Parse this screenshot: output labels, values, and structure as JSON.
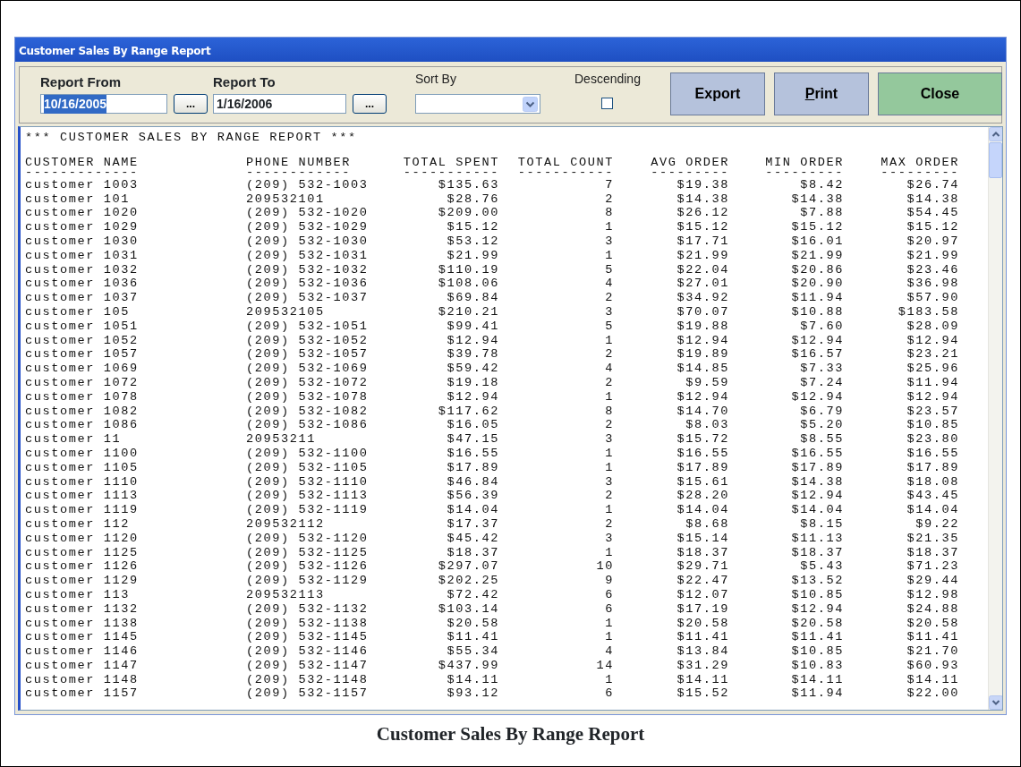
{
  "window": {
    "title": "Customer Sales By Range Report"
  },
  "toolbar": {
    "report_from": {
      "label": "Report From",
      "value": "10/16/2005",
      "text_selected": true,
      "picker": "..."
    },
    "report_to": {
      "label": "Report To",
      "value": "1/16/2006",
      "text_selected": false,
      "picker": "..."
    },
    "sort_by": {
      "label": "Sort By"
    },
    "descending": {
      "label": "Descending",
      "checked": false
    },
    "buttons": [
      {
        "label": "Export",
        "kind": "blue",
        "mnemonic_underlined": false
      },
      {
        "label": "Print",
        "kind": "blue",
        "mnemonic_underlined": true
      },
      {
        "label": "Close",
        "kind": "green",
        "mnemonic_underlined": false
      }
    ]
  },
  "report": {
    "title": "*** CUSTOMER SALES BY RANGE REPORT ***",
    "columns": [
      {
        "heading": "CUSTOMER NAME",
        "rule": "-------------"
      },
      {
        "heading": "PHONE NUMBER",
        "rule": "------------"
      },
      {
        "heading": "TOTAL SPENT",
        "rule": "-----------"
      },
      {
        "heading": "TOTAL COUNT",
        "rule": "-----------"
      },
      {
        "heading": "AVG ORDER",
        "rule": "---------"
      },
      {
        "heading": "MIN ORDER",
        "rule": "---------"
      },
      {
        "heading": "MAX ORDER",
        "rule": "---------"
      }
    ],
    "rows": [
      [
        "customer 1003",
        "(209) 532-1003",
        "$135.63",
        "7",
        "$19.38",
        "$8.42",
        "$26.74"
      ],
      [
        "customer 101",
        "209532101",
        "$28.76",
        "2",
        "$14.38",
        "$14.38",
        "$14.38"
      ],
      [
        "customer 1020",
        "(209) 532-1020",
        "$209.00",
        "8",
        "$26.12",
        "$7.88",
        "$54.45"
      ],
      [
        "customer 1029",
        "(209) 532-1029",
        "$15.12",
        "1",
        "$15.12",
        "$15.12",
        "$15.12"
      ],
      [
        "customer 1030",
        "(209) 532-1030",
        "$53.12",
        "3",
        "$17.71",
        "$16.01",
        "$20.97"
      ],
      [
        "customer 1031",
        "(209) 532-1031",
        "$21.99",
        "1",
        "$21.99",
        "$21.99",
        "$21.99"
      ],
      [
        "customer 1032",
        "(209) 532-1032",
        "$110.19",
        "5",
        "$22.04",
        "$20.86",
        "$23.46"
      ],
      [
        "customer 1036",
        "(209) 532-1036",
        "$108.06",
        "4",
        "$27.01",
        "$20.90",
        "$36.98"
      ],
      [
        "customer 1037",
        "(209) 532-1037",
        "$69.84",
        "2",
        "$34.92",
        "$11.94",
        "$57.90"
      ],
      [
        "customer 105",
        "209532105",
        "$210.21",
        "3",
        "$70.07",
        "$10.88",
        "$183.58"
      ],
      [
        "customer 1051",
        "(209) 532-1051",
        "$99.41",
        "5",
        "$19.88",
        "$7.60",
        "$28.09"
      ],
      [
        "customer 1052",
        "(209) 532-1052",
        "$12.94",
        "1",
        "$12.94",
        "$12.94",
        "$12.94"
      ],
      [
        "customer 1057",
        "(209) 532-1057",
        "$39.78",
        "2",
        "$19.89",
        "$16.57",
        "$23.21"
      ],
      [
        "customer 1069",
        "(209) 532-1069",
        "$59.42",
        "4",
        "$14.85",
        "$7.33",
        "$25.96"
      ],
      [
        "customer 1072",
        "(209) 532-1072",
        "$19.18",
        "2",
        "$9.59",
        "$7.24",
        "$11.94"
      ],
      [
        "customer 1078",
        "(209) 532-1078",
        "$12.94",
        "1",
        "$12.94",
        "$12.94",
        "$12.94"
      ],
      [
        "customer 1082",
        "(209) 532-1082",
        "$117.62",
        "8",
        "$14.70",
        "$6.79",
        "$23.57"
      ],
      [
        "customer 1086",
        "(209) 532-1086",
        "$16.05",
        "2",
        "$8.03",
        "$5.20",
        "$10.85"
      ],
      [
        "customer 11",
        "20953211",
        "$47.15",
        "3",
        "$15.72",
        "$8.55",
        "$23.80"
      ],
      [
        "customer 1100",
        "(209) 532-1100",
        "$16.55",
        "1",
        "$16.55",
        "$16.55",
        "$16.55"
      ],
      [
        "customer 1105",
        "(209) 532-1105",
        "$17.89",
        "1",
        "$17.89",
        "$17.89",
        "$17.89"
      ],
      [
        "customer 1110",
        "(209) 532-1110",
        "$46.84",
        "3",
        "$15.61",
        "$14.38",
        "$18.08"
      ],
      [
        "customer 1113",
        "(209) 532-1113",
        "$56.39",
        "2",
        "$28.20",
        "$12.94",
        "$43.45"
      ],
      [
        "customer 1119",
        "(209) 532-1119",
        "$14.04",
        "1",
        "$14.04",
        "$14.04",
        "$14.04"
      ],
      [
        "customer 112",
        "209532112",
        "$17.37",
        "2",
        "$8.68",
        "$8.15",
        "$9.22"
      ],
      [
        "customer 1120",
        "(209) 532-1120",
        "$45.42",
        "3",
        "$15.14",
        "$11.13",
        "$21.35"
      ],
      [
        "customer 1125",
        "(209) 532-1125",
        "$18.37",
        "1",
        "$18.37",
        "$18.37",
        "$18.37"
      ],
      [
        "customer 1126",
        "(209) 532-1126",
        "$297.07",
        "10",
        "$29.71",
        "$5.43",
        "$71.23"
      ],
      [
        "customer 1129",
        "(209) 532-1129",
        "$202.25",
        "9",
        "$22.47",
        "$13.52",
        "$29.44"
      ],
      [
        "customer 113",
        "209532113",
        "$72.42",
        "6",
        "$12.07",
        "$10.85",
        "$12.98"
      ],
      [
        "customer 1132",
        "(209) 532-1132",
        "$103.14",
        "6",
        "$17.19",
        "$12.94",
        "$24.88"
      ],
      [
        "customer 1138",
        "(209) 532-1138",
        "$20.58",
        "1",
        "$20.58",
        "$20.58",
        "$20.58"
      ],
      [
        "customer 1145",
        "(209) 532-1145",
        "$11.41",
        "1",
        "$11.41",
        "$11.41",
        "$11.41"
      ],
      [
        "customer 1146",
        "(209) 532-1146",
        "$55.34",
        "4",
        "$13.84",
        "$10.85",
        "$21.70"
      ],
      [
        "customer 1147",
        "(209) 532-1147",
        "$437.99",
        "14",
        "$31.29",
        "$10.83",
        "$60.93"
      ],
      [
        "customer 1148",
        "(209) 532-1148",
        "$14.11",
        "1",
        "$14.11",
        "$14.11",
        "$14.11"
      ],
      [
        "customer 1157",
        "(209) 532-1157",
        "$93.12",
        "6",
        "$15.52",
        "$11.94",
        "$22.00"
      ]
    ]
  },
  "caption": "Customer Sales By Range Report"
}
